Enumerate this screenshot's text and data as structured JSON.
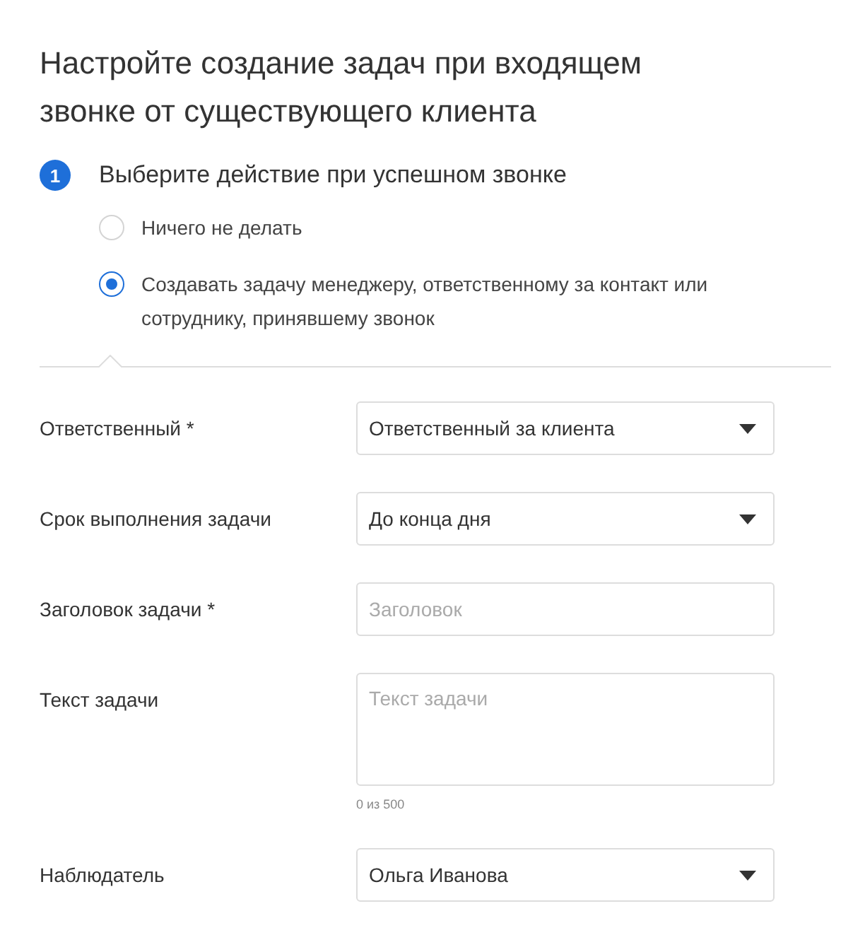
{
  "title": "Настройте создание задач при входящем звонке от существующего клиента",
  "step": {
    "number": "1",
    "title": "Выберите действие при успешном звонке"
  },
  "options": [
    {
      "label": "Ничего не делать",
      "selected": false
    },
    {
      "label": "Создавать задачу менеджеру, ответственному за контакт или сотруднику, принявшему звонок",
      "selected": true
    }
  ],
  "fields": [
    {
      "kind": "select",
      "label": "Ответственный *",
      "value": "Ответственный за клиента"
    },
    {
      "kind": "select",
      "label": "Срок выполнения задачи",
      "value": "До конца дня"
    },
    {
      "kind": "input",
      "label": "Заголовок задачи *",
      "placeholder": "Заголовок"
    },
    {
      "kind": "textarea",
      "label": "Текст задачи",
      "placeholder": "Текст задачи",
      "counter": "0 из 500"
    },
    {
      "kind": "select",
      "label": "Наблюдатель",
      "value": "Ольга Иванова"
    }
  ]
}
